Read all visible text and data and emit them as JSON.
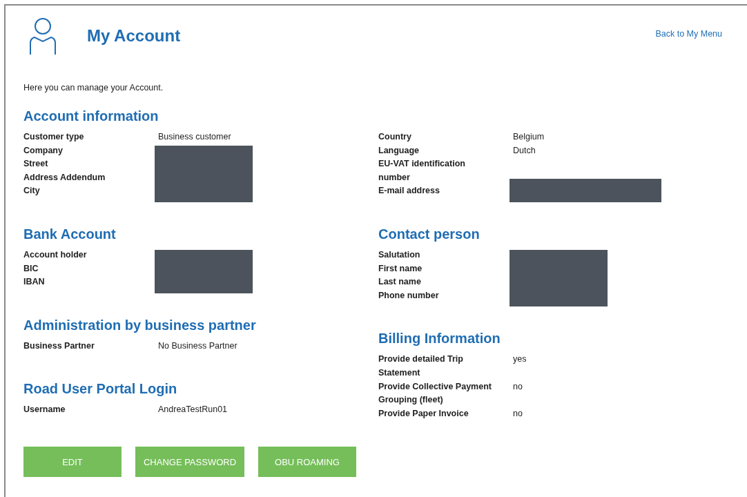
{
  "header": {
    "title": "My Account",
    "back_link": "Back to My Menu"
  },
  "intro": "Here you can manage your Account.",
  "columns": [
    [
      {
        "title": "Account information",
        "fields": [
          {
            "label": "Customer type",
            "value": "Business customer",
            "redacted": false
          },
          {
            "label": "Company",
            "redacted": true
          },
          {
            "label": "Street",
            "redacted": true
          },
          {
            "label": "Address Addendum",
            "redacted": true
          },
          {
            "label": "City",
            "redacted": true
          }
        ]
      },
      {
        "title": "Bank Account",
        "fields": [
          {
            "label": "Account holder",
            "redacted": true
          },
          {
            "label": "BIC",
            "redacted": true
          },
          {
            "label": "IBAN",
            "redacted": true
          }
        ]
      },
      {
        "title": "Administration by business partner",
        "fields": [
          {
            "label": "Business Partner",
            "value": "No Business Partner",
            "redacted": false
          }
        ]
      },
      {
        "title": "Road User Portal Login",
        "fields": [
          {
            "label": "Username",
            "value": "AndreaTestRun01",
            "redacted": false
          }
        ]
      }
    ],
    [
      {
        "fields": [
          {
            "label": "Country",
            "value": "Belgium",
            "redacted": false
          },
          {
            "label": "Language",
            "value": "Dutch",
            "redacted": false
          },
          {
            "label": "EU-VAT identification number",
            "redacted": false
          },
          {
            "label": "E-mail address",
            "redacted": true
          }
        ]
      },
      {
        "title": "Contact person",
        "fields": [
          {
            "label": "Salutation",
            "redacted": true
          },
          {
            "label": "First name",
            "redacted": true
          },
          {
            "label": "Last name",
            "redacted": true
          },
          {
            "label": "Phone number",
            "redacted": true
          }
        ]
      },
      {
        "title": "Billing Information",
        "fields": [
          {
            "label": "Provide detailed Trip Statement",
            "value": "yes",
            "redacted": false
          },
          {
            "label": "Provide Collective Payment Grouping (fleet)",
            "value": "no",
            "redacted": false
          },
          {
            "label": "Provide Paper Invoice",
            "value": "no",
            "redacted": false
          }
        ]
      }
    ]
  ],
  "buttons": [
    "EDIT",
    "CHANGE PASSWORD",
    "OBU ROAMING"
  ]
}
